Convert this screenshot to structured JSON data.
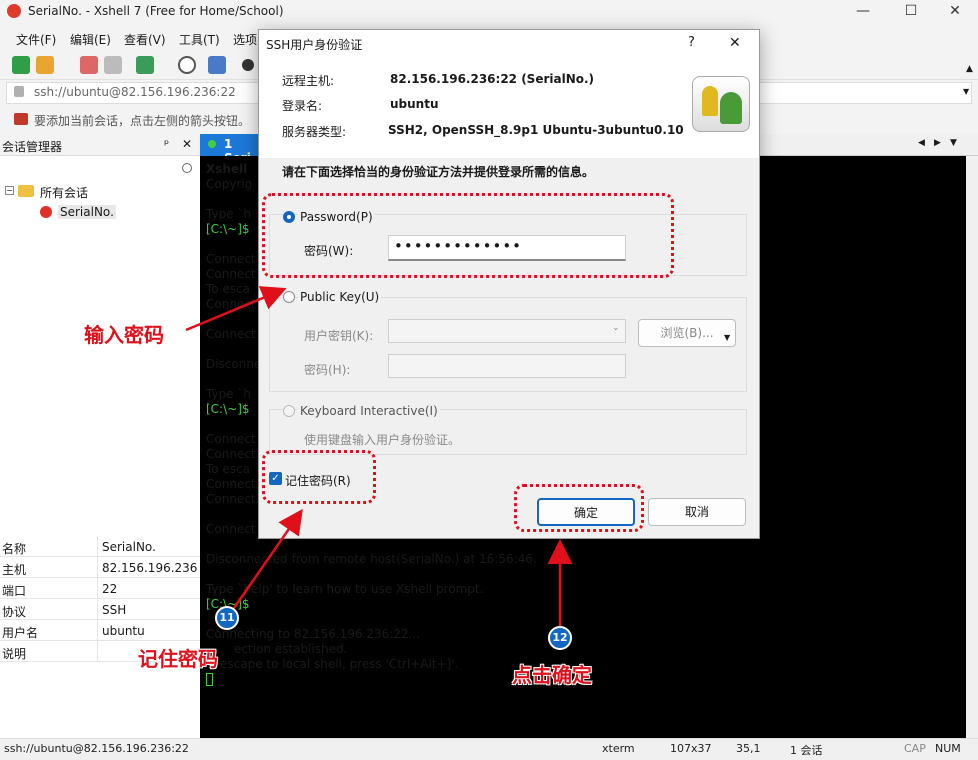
{
  "window": {
    "title": "SerialNo. - Xshell 7 (Free for Home/School)",
    "minimize": "—",
    "maximize": "☐",
    "close": "✕"
  },
  "menu": [
    "文件(F)",
    "编辑(E)",
    "查看(V)",
    "工具(T)",
    "选项"
  ],
  "address": "ssh://ubuntu@82.156.196.236:22",
  "hint": "要添加当前会话，点击左侧的箭头按钮。",
  "session_manager": {
    "title": "会话管理器",
    "pin": "ᵖ",
    "close": "✕",
    "root": "所有会话",
    "child": "SerialNo."
  },
  "properties": [
    {
      "k": "名称",
      "v": "SerialNo."
    },
    {
      "k": "主机",
      "v": "82.156.196.236"
    },
    {
      "k": "端口",
      "v": "22"
    },
    {
      "k": "协议",
      "v": "SSH"
    },
    {
      "k": "用户名",
      "v": "ubuntu"
    },
    {
      "k": "说明",
      "v": ""
    }
  ],
  "tab": {
    "label": "1 Seri"
  },
  "terminal": {
    "lines_left": [
      "Xshell ",
      "Copyrig",
      "",
      "Type `h",
      "[C:\\~]$",
      "",
      "Connect",
      "Connect",
      "To esca",
      "Connect",
      "",
      "Connect",
      "",
      "Disconne",
      "",
      "Type `h",
      "[C:\\~]$",
      "",
      "Connect",
      "Connect",
      "To esca",
      "Connect",
      "Connect",
      "",
      "Connect"
    ],
    "disconnected": "Disconnected from remote host(SerialNo.) at 16:56:46.",
    "type_help": "Type `help' to learn how to use Xshell prompt.",
    "prompt": "[C:\\~]$",
    "connecting": "Connecting to 82.156.196.236:22...",
    "established": "ection established.",
    "escape": "escape to local shell, press 'Ctrl+Alt+]'."
  },
  "dialog": {
    "title": "SSH用户身份验证",
    "help": "?",
    "close": "✕",
    "host_label": "远程主机:",
    "host_value": "82.156.196.236:22 (SerialNo.)",
    "login_label": "登录名:",
    "login_value": "ubuntu",
    "server_label": "服务器类型:",
    "server_value": "SSH2, OpenSSH_8.9p1 Ubuntu-3ubuntu0.10",
    "instruction": "请在下面选择恰当的身份验证方法并提供登录所需的信息。",
    "password_option": "Password(P)",
    "password_label": "密码(W):",
    "password_value": "•••••••••••••",
    "pubkey_option": "Public Key(U)",
    "user_key_label": "用户密钥(K):",
    "browse_label": "浏览(B)...",
    "passphrase_label": "密码(H):",
    "keyboard_option": "Keyboard Interactive(I)",
    "keyboard_desc": "使用键盘输入用户身份验证。",
    "remember_label": "记住密码(R)",
    "ok_label": "确定",
    "cancel_label": "取消"
  },
  "annotations": {
    "enter_password": "输入密码",
    "remember_password": "记住密码",
    "click_ok": "点击确定",
    "badge_11": "11",
    "badge_12": "12"
  },
  "status": {
    "url": "ssh://ubuntu@82.156.196.236:22",
    "term": "xterm",
    "size": "107x37",
    "pos": "35,1",
    "sessions": "1 会话",
    "cap": "CAP",
    "num": "NUM"
  }
}
